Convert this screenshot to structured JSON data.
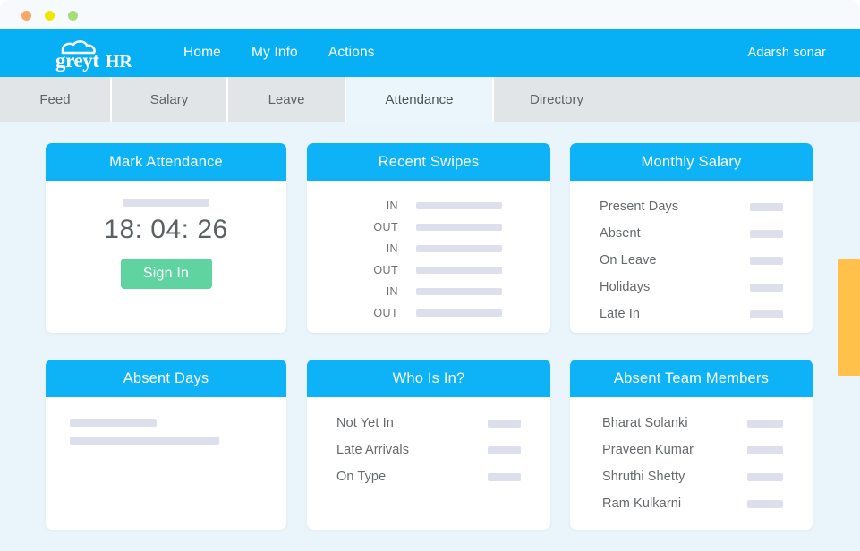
{
  "window": {
    "dots": [
      "close-dot",
      "minimize-dot",
      "maximize-dot"
    ],
    "colors": {
      "close": "#f9a765",
      "minimize": "#f2e500",
      "maximize": "#a9dc79"
    }
  },
  "topnav": {
    "brand": "greytHR",
    "brand_icon": "cloud-icon",
    "links": [
      {
        "label": "Home"
      },
      {
        "label": "My Info"
      },
      {
        "label": "Actions"
      }
    ],
    "user": "Adarsh sonar",
    "background": "#07b0f5"
  },
  "tabs": [
    {
      "label": "Feed",
      "active": false
    },
    {
      "label": "Salary",
      "active": false
    },
    {
      "label": "Leave",
      "active": false
    },
    {
      "label": "Attendance",
      "active": true
    },
    {
      "label": "Directory",
      "active": false
    }
  ],
  "cards": {
    "mark_attendance": {
      "title": "Mark Attendance",
      "clock": "18: 04: 26",
      "button_label": "Sign In",
      "button_color": "#5fd3a0"
    },
    "recent_swipes": {
      "title": "Recent Swipes",
      "rows": [
        {
          "label": "IN"
        },
        {
          "label": "OUT"
        },
        {
          "label": "IN"
        },
        {
          "label": "OUT"
        },
        {
          "label": "IN"
        },
        {
          "label": "OUT"
        }
      ]
    },
    "monthly_salary": {
      "title": "Monthly Salary",
      "rows": [
        {
          "label": "Present Days"
        },
        {
          "label": "Absent"
        },
        {
          "label": "On Leave"
        },
        {
          "label": "Holidays"
        },
        {
          "label": "Late In"
        }
      ]
    },
    "absent_days": {
      "title": "Absent Days"
    },
    "who_is_in": {
      "title": "Who Is In?",
      "rows": [
        {
          "label": "Not Yet In"
        },
        {
          "label": "Late Arrivals"
        },
        {
          "label": "On Type"
        }
      ]
    },
    "absent_team_members": {
      "title": "Absent Team Members",
      "rows": [
        {
          "label": "Bharat Solanki"
        },
        {
          "label": "Praveen Kumar"
        },
        {
          "label": "Shruthi Shetty"
        },
        {
          "label": "Ram Kulkarni"
        }
      ]
    }
  },
  "theme": {
    "accent": "#0db2f7",
    "page_background": "#eaf4fb",
    "skeleton": "#dde0ec",
    "scrollbar": "#ffc14a"
  }
}
